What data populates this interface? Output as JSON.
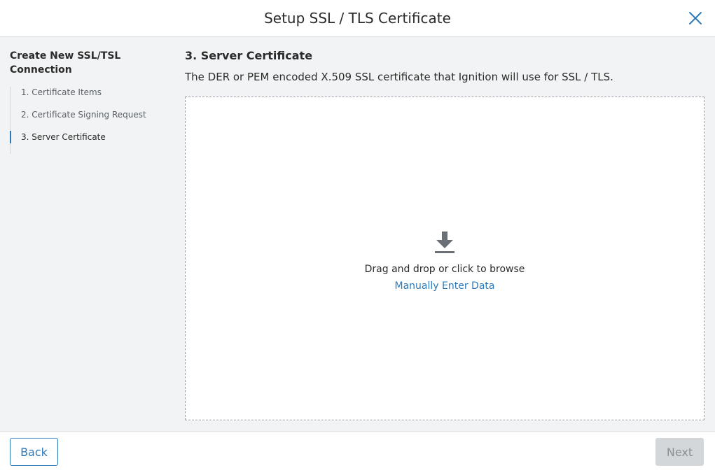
{
  "header": {
    "title": "Setup SSL / TLS Certificate",
    "close_icon": "close-icon"
  },
  "sidebar": {
    "heading": "Create New SSL/TSL Connection",
    "steps": [
      {
        "label": "1. Certificate Items",
        "active": false
      },
      {
        "label": "2. Certificate Signing Request",
        "active": false
      },
      {
        "label": "3. Server Certificate",
        "active": true
      }
    ]
  },
  "main": {
    "section_title": "3. Server Certificate",
    "description": "The DER or PEM encoded X.509 SSL certificate that Ignition will use for SSL / TLS.",
    "dropzone": {
      "icon": "download-icon",
      "text": "Drag and drop or click to browse",
      "manual_link": "Manually Enter Data"
    }
  },
  "footer": {
    "back_label": "Back",
    "next_label": "Next",
    "next_disabled": true
  },
  "colors": {
    "accent": "#2e79b9",
    "background": "#f2f3f4",
    "disabled": "#d4d7da"
  }
}
